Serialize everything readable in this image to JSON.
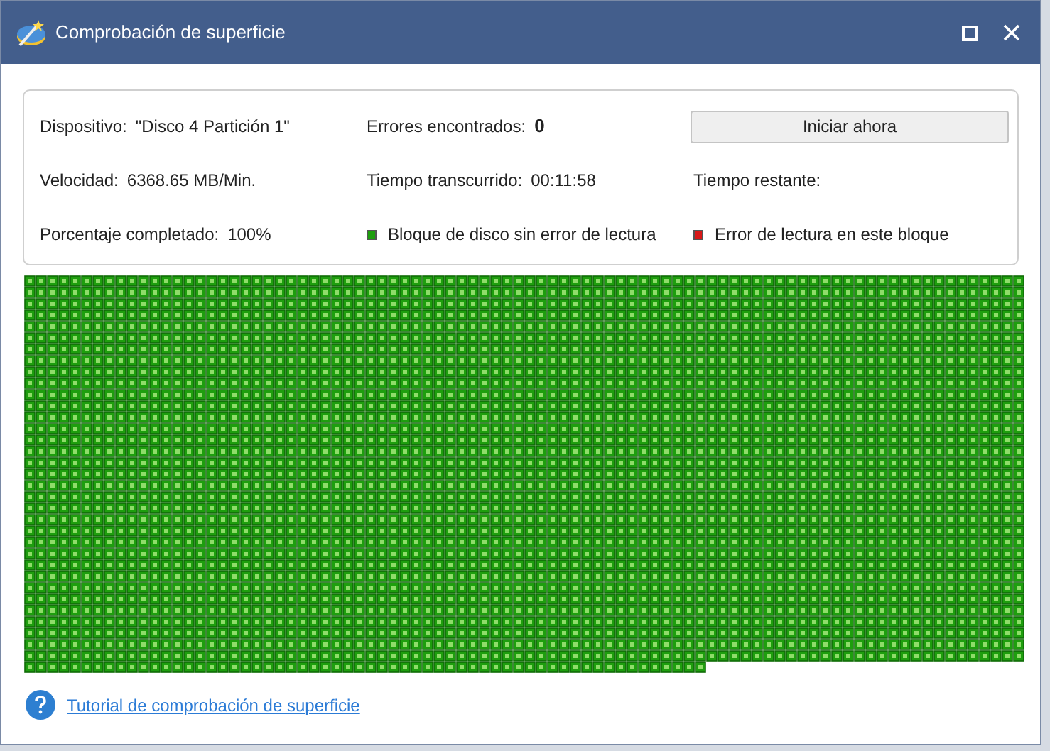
{
  "window": {
    "title": "Comprobación de superficie"
  },
  "info": [
    {
      "label": "Dispositivo:",
      "value": "\"Disco 4 Partición 1\""
    },
    {
      "label": "Errores encontrados:",
      "value": "0",
      "bold": true
    },
    {
      "label": "Velocidad:",
      "value": "6368.65 MB/Min."
    },
    {
      "label": "Tiempo transcurrido:",
      "value": "00:11:58"
    },
    {
      "label": "Tiempo restante:"
    },
    {
      "label": "Porcentaje completado:",
      "value": "100%"
    }
  ],
  "start_button": "Iniciar ahora",
  "legend": [
    {
      "label": "Bloque de disco sin error de lectura",
      "color": "#1e9e0e"
    },
    {
      "label": "Error de lectura en este bloque",
      "color": "#d81818"
    }
  ],
  "help_link": "Tutorial de comprobación de superficie"
}
